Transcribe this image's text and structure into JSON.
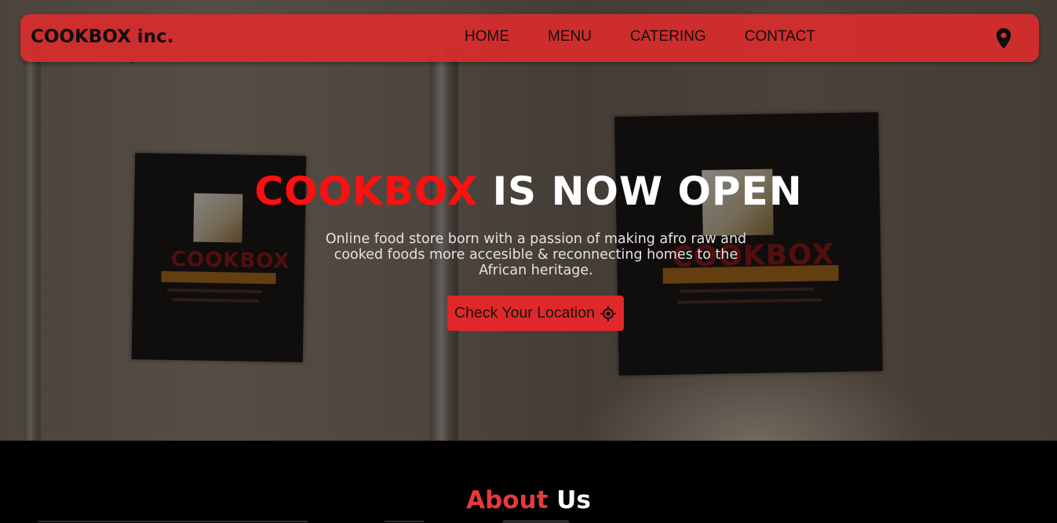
{
  "navbar": {
    "brand": "COOKBOX inc.",
    "links": [
      "HOME",
      "MENU",
      "CATERING",
      "CONTACT"
    ],
    "location_icon": "map-pin-icon"
  },
  "hero": {
    "headline_accent": "COOKBOX",
    "headline_rest": "IS NOW OPEN",
    "tagline": "Online food store born with a passion of making afro raw and cooked foods more accesible & reconnecting homes to the African heritage.",
    "cta_label": "Check Your Location",
    "cta_icon": "crosshair-target-icon"
  },
  "about": {
    "title_accent": "About",
    "title_rest": "Us"
  },
  "colors": {
    "brand_red": "#d92d2d",
    "headline_red": "#ff1010",
    "background": "#000000"
  }
}
